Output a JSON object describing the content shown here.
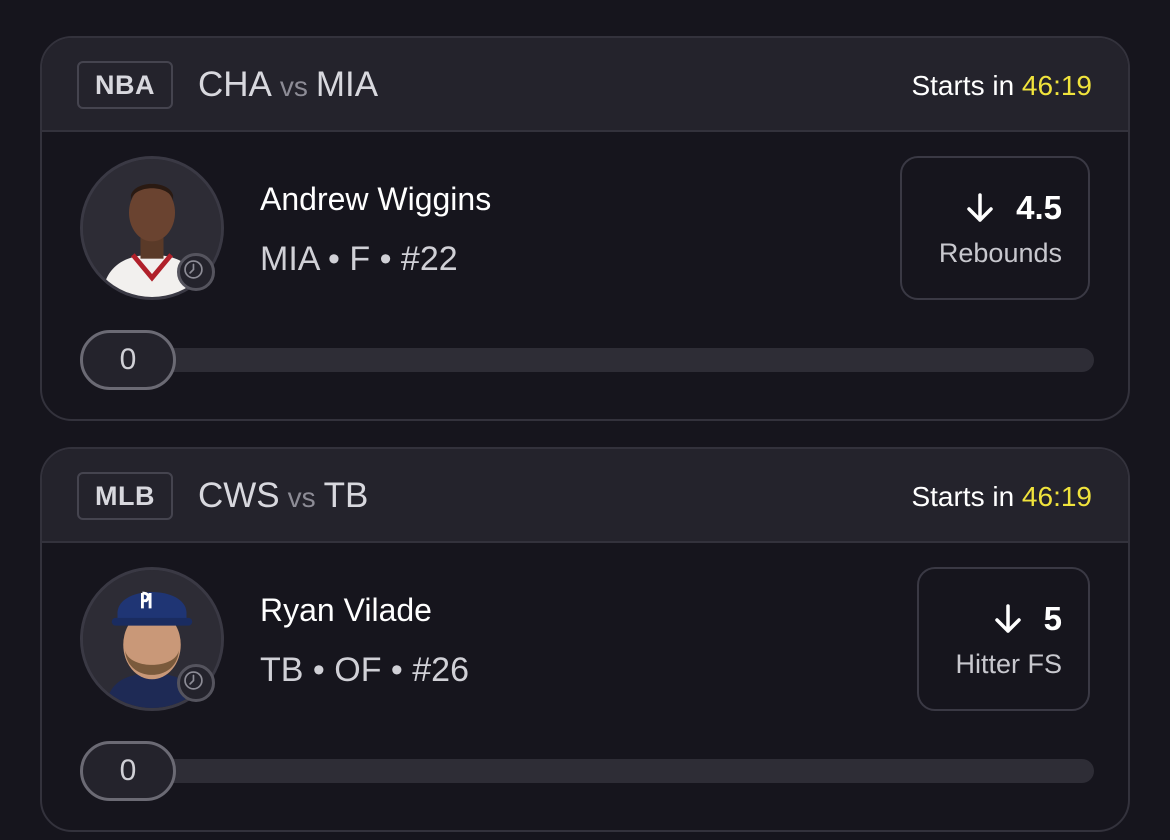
{
  "cards": [
    {
      "league": "NBA",
      "team_a": "CHA",
      "vs": "vs",
      "team_b": "MIA",
      "starts_prefix": "Starts in",
      "starts_time": "46:19",
      "player_name": "Andrew Wiggins",
      "player_meta": "MIA • F • #22",
      "stat_value": "4.5",
      "stat_label": "Rebounds",
      "stat_direction_icon": "arrow-down-icon",
      "progress_value": "0",
      "progress_fraction": 0
    },
    {
      "league": "MLB",
      "team_a": "CWS",
      "vs": "vs",
      "team_b": "TB",
      "starts_prefix": "Starts in",
      "starts_time": "46:19",
      "player_name": "Ryan Vilade",
      "player_meta": "TB • OF • #26",
      "stat_value": "5",
      "stat_label": "Hitter FS",
      "stat_direction_icon": "arrow-down-icon",
      "progress_value": "0",
      "progress_fraction": 0
    }
  ],
  "colors": {
    "background": "#16151d",
    "header": "#24232c",
    "accent_time": "#f0e33c",
    "border": "#33323c"
  }
}
